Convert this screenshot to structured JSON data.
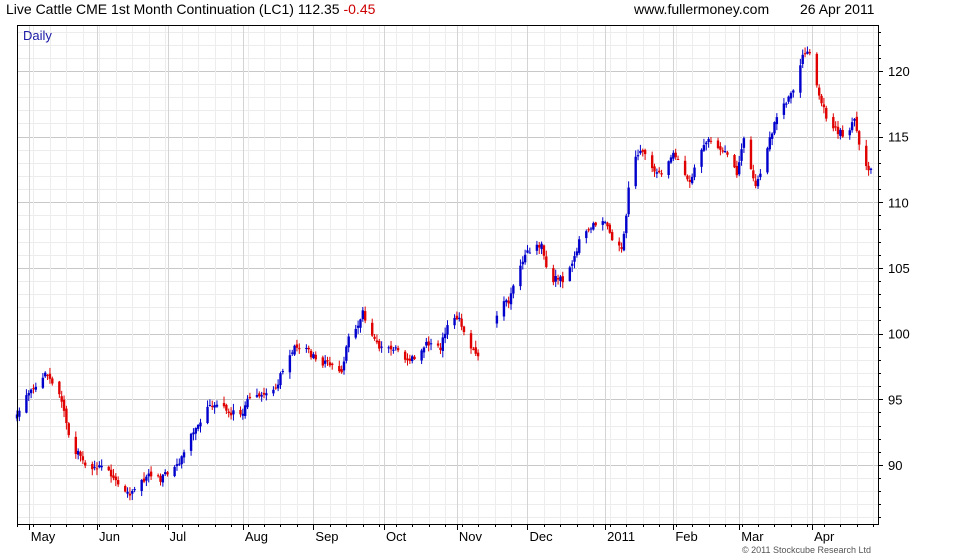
{
  "header": {
    "title": "Live Cattle CME 1st Month Continuation (LC1)",
    "last_price": "112.35",
    "change": "-0.45",
    "website": "www.fullermoney.com",
    "date": "26 Apr 2011"
  },
  "copyright": "© 2011 Stockcube Research Ltd",
  "colors": {
    "up": "#0000cc",
    "down": "#e00000",
    "grid": "#dcdcdc",
    "axis": "#000000"
  },
  "chart_data": {
    "type": "candlestick",
    "period_label": "Daily",
    "ylim": [
      85.5,
      123.5
    ],
    "y_ticks": [
      90,
      95,
      100,
      105,
      110,
      115,
      120
    ],
    "y_axis_side": "right",
    "grid": true,
    "x_ticks": [
      {
        "label": "May",
        "date": "2010-05-03"
      },
      {
        "label": "Jun",
        "date": "2010-06-01"
      },
      {
        "label": "Jul",
        "date": "2010-07-01"
      },
      {
        "label": "Aug",
        "date": "2010-08-02"
      },
      {
        "label": "Sep",
        "date": "2010-09-01"
      },
      {
        "label": "Oct",
        "date": "2010-10-01"
      },
      {
        "label": "Nov",
        "date": "2010-11-01"
      },
      {
        "label": "Dec",
        "date": "2010-12-01"
      },
      {
        "label": "2011",
        "date": "2011-01-03"
      },
      {
        "label": "Feb",
        "date": "2011-02-01"
      },
      {
        "label": "Mar",
        "date": "2011-03-01"
      },
      {
        "label": "Apr",
        "date": "2011-04-01"
      }
    ],
    "x_range": [
      "2010-04-28",
      "2011-04-29"
    ],
    "close_series": [
      [
        "2010-04-28",
        93.8
      ],
      [
        "2010-05-04",
        95.8
      ],
      [
        "2010-05-10",
        96.8
      ],
      [
        "2010-05-12",
        96.6
      ],
      [
        "2010-05-17",
        94.9
      ],
      [
        "2010-05-21",
        91.3
      ],
      [
        "2010-05-25",
        90.8
      ],
      [
        "2010-05-28",
        89.6
      ],
      [
        "2010-06-02",
        89.8
      ],
      [
        "2010-06-04",
        90.4
      ],
      [
        "2010-06-08",
        89.0
      ],
      [
        "2010-06-11",
        88.2
      ],
      [
        "2010-06-15",
        87.9
      ],
      [
        "2010-06-18",
        88.4
      ],
      [
        "2010-06-23",
        89.1
      ],
      [
        "2010-06-28",
        88.9
      ],
      [
        "2010-07-01",
        89.4
      ],
      [
        "2010-07-06",
        90.2
      ],
      [
        "2010-07-09",
        91.6
      ],
      [
        "2010-07-14",
        93.0
      ],
      [
        "2010-07-19",
        94.6
      ],
      [
        "2010-07-23",
        94.8
      ],
      [
        "2010-07-28",
        93.9
      ],
      [
        "2010-08-02",
        94.1
      ],
      [
        "2010-08-06",
        95.6
      ],
      [
        "2010-08-11",
        95.3
      ],
      [
        "2010-08-16",
        95.7
      ],
      [
        "2010-08-20",
        97.8
      ],
      [
        "2010-08-25",
        99.1
      ],
      [
        "2010-08-30",
        98.6
      ],
      [
        "2010-09-03",
        97.9
      ],
      [
        "2010-09-08",
        97.6
      ],
      [
        "2010-09-13",
        97.1
      ],
      [
        "2010-09-16",
        99.8
      ],
      [
        "2010-09-20",
        100.6
      ],
      [
        "2010-09-22",
        101.6
      ],
      [
        "2010-09-24",
        100.4
      ],
      [
        "2010-09-28",
        99.2
      ],
      [
        "2010-10-01",
        98.7
      ],
      [
        "2010-10-06",
        99.0
      ],
      [
        "2010-10-11",
        98.0
      ],
      [
        "2010-10-15",
        98.4
      ],
      [
        "2010-10-20",
        99.3
      ],
      [
        "2010-10-25",
        98.9
      ],
      [
        "2010-10-29",
        101.4
      ],
      [
        "2010-11-02",
        101.0
      ],
      [
        "2010-11-05",
        99.6
      ],
      [
        "2010-11-09",
        98.3
      ],
      [
        "2010-11-12",
        97.9
      ],
      [
        "2010-11-16",
        98.5
      ],
      [
        "2010-11-19",
        102.5
      ],
      [
        "2010-11-23",
        102.3
      ],
      [
        "2010-11-26",
        104.5
      ],
      [
        "2010-11-30",
        106.1
      ],
      [
        "2010-12-03",
        106.5
      ],
      [
        "2010-12-07",
        106.6
      ],
      [
        "2010-12-10",
        104.1
      ],
      [
        "2010-12-14",
        104.2
      ],
      [
        "2010-12-17",
        104.0
      ],
      [
        "2010-12-21",
        105.8
      ],
      [
        "2010-12-24",
        107.6
      ],
      [
        "2010-12-29",
        108.4
      ],
      [
        "2011-01-03",
        108.6
      ],
      [
        "2011-01-06",
        106.9
      ],
      [
        "2011-01-10",
        106.7
      ],
      [
        "2011-01-12",
        108.9
      ],
      [
        "2011-01-14",
        113.1
      ],
      [
        "2011-01-19",
        113.8
      ],
      [
        "2011-01-24",
        112.5
      ],
      [
        "2011-01-27",
        112.0
      ],
      [
        "2011-02-01",
        114.0
      ],
      [
        "2011-02-04",
        112.8
      ],
      [
        "2011-02-08",
        111.5
      ],
      [
        "2011-02-11",
        113.4
      ],
      [
        "2011-02-16",
        114.9
      ],
      [
        "2011-02-21",
        114.0
      ],
      [
        "2011-02-24",
        113.8
      ],
      [
        "2011-02-28",
        112.2
      ],
      [
        "2011-03-03",
        114.7
      ],
      [
        "2011-03-08",
        111.2
      ],
      [
        "2011-03-11",
        112.6
      ],
      [
        "2011-03-16",
        116.2
      ],
      [
        "2011-03-21",
        117.6
      ],
      [
        "2011-03-24",
        118.6
      ],
      [
        "2011-03-28",
        121.0
      ],
      [
        "2011-03-31",
        121.4
      ],
      [
        "2011-04-04",
        118.3
      ],
      [
        "2011-04-07",
        116.6
      ],
      [
        "2011-04-12",
        115.3
      ],
      [
        "2011-04-15",
        115.2
      ],
      [
        "2011-04-19",
        116.2
      ],
      [
        "2011-04-22",
        113.3
      ],
      [
        "2011-04-26",
        112.35
      ]
    ]
  }
}
